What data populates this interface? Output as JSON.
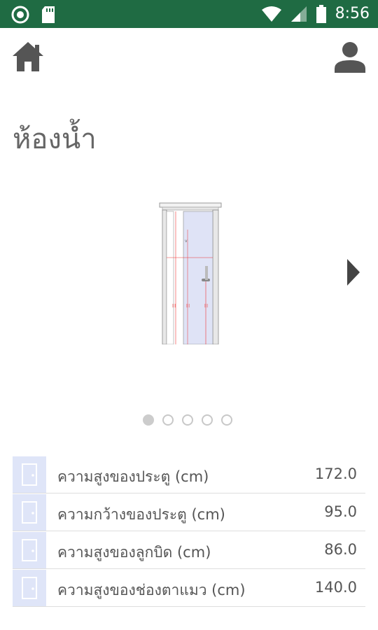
{
  "status_bar": {
    "time": "8:56",
    "icons": [
      "circle-notification-icon",
      "sd-card-icon",
      "wifi-icon",
      "cellular-signal-icon",
      "battery-icon"
    ],
    "background": "#1f6b43"
  },
  "app_bar": {
    "home_icon": "home-icon",
    "profile_icon": "person-icon"
  },
  "page": {
    "title": "ห้องน้ำ"
  },
  "carousel": {
    "image": "door-drawing",
    "next_icon": "chevron-right-icon",
    "page_count": 5,
    "active_index": 0
  },
  "measurements": [
    {
      "label": "ความสูงของประตู (cm)",
      "value": "172.0",
      "icon": "door-icon"
    },
    {
      "label": "ความกว้างของประตู (cm)",
      "value": "95.0",
      "icon": "door-icon"
    },
    {
      "label": "ความสูงของลูกบิด (cm)",
      "value": "86.0",
      "icon": "door-icon"
    },
    {
      "label": "ความสูงของช่องตาแมว (cm)",
      "value": "140.0",
      "icon": "door-icon"
    }
  ],
  "colors": {
    "accent": "#1f6b43",
    "icon_gray": "#555555",
    "thumb_bg": "#dfe5f8"
  }
}
